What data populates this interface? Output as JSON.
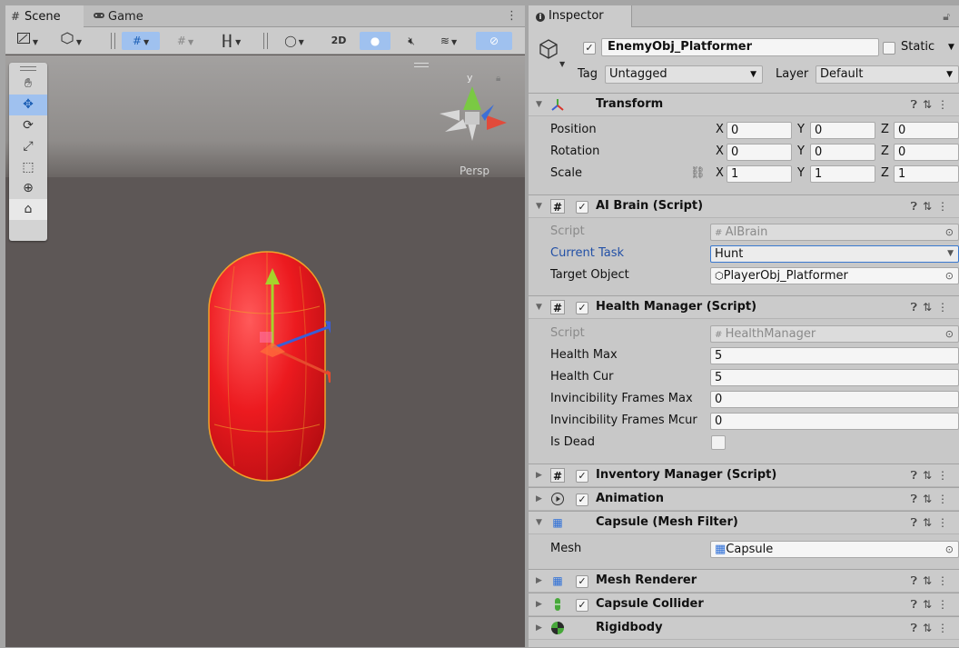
{
  "scene_window": {
    "tabs": [
      {
        "label": "Scene",
        "icon": "hash-icon"
      },
      {
        "label": "Game",
        "icon": "gamepad-icon"
      }
    ],
    "toolbar": {
      "twod_label": "2D"
    },
    "persp_label": "Persp",
    "gizmo_axis_label": "y",
    "tools": [
      "hand-tool",
      "move-tool",
      "rotate-tool",
      "scale-tool",
      "rect-tool",
      "transform-tool",
      "custom-tool"
    ]
  },
  "inspector": {
    "tab_label": "Inspector",
    "object_name": "EnemyObj_Platformer",
    "static_label": "Static",
    "tag_label": "Tag",
    "tag_value": "Untagged",
    "layer_label": "Layer",
    "layer_value": "Default",
    "transform": {
      "title": "Transform",
      "position_label": "Position",
      "rotation_label": "Rotation",
      "scale_label": "Scale",
      "position": {
        "x": "0",
        "y": "0",
        "z": "0"
      },
      "rotation": {
        "x": "0",
        "y": "0",
        "z": "0"
      },
      "scale": {
        "x": "1",
        "y": "1",
        "z": "1"
      },
      "axis_x": "X",
      "axis_y": "Y",
      "axis_z": "Z"
    },
    "ai_brain": {
      "title": "AI Brain (Script)",
      "script_label": "Script",
      "script_value": "AIBrain",
      "current_task_label": "Current Task",
      "current_task_value": "Hunt",
      "target_object_label": "Target Object",
      "target_object_value": "PlayerObj_Platformer"
    },
    "health_manager": {
      "title": "Health Manager (Script)",
      "script_label": "Script",
      "script_value": "HealthManager",
      "health_max_label": "Health Max",
      "health_max_value": "5",
      "health_cur_label": "Health Cur",
      "health_cur_value": "5",
      "inv_max_label": "Invincibility Frames Max",
      "inv_max_value": "0",
      "inv_mcur_label": "Invincibility Frames Mcur",
      "inv_mcur_value": "0",
      "is_dead_label": "Is Dead"
    },
    "inventory_manager": {
      "title": "Inventory Manager (Script)"
    },
    "animation": {
      "title": "Animation"
    },
    "mesh_filter": {
      "title": "Capsule (Mesh Filter)",
      "mesh_label": "Mesh",
      "mesh_value": "Capsule"
    },
    "mesh_renderer": {
      "title": "Mesh Renderer"
    },
    "capsule_collider": {
      "title": "Capsule Collider"
    },
    "rigidbody": {
      "title": "Rigidbody"
    }
  },
  "colors": {
    "capsule_red": "#e8171b",
    "selection_blue": "#9fc1ef",
    "link_blue": "#2250a6"
  }
}
